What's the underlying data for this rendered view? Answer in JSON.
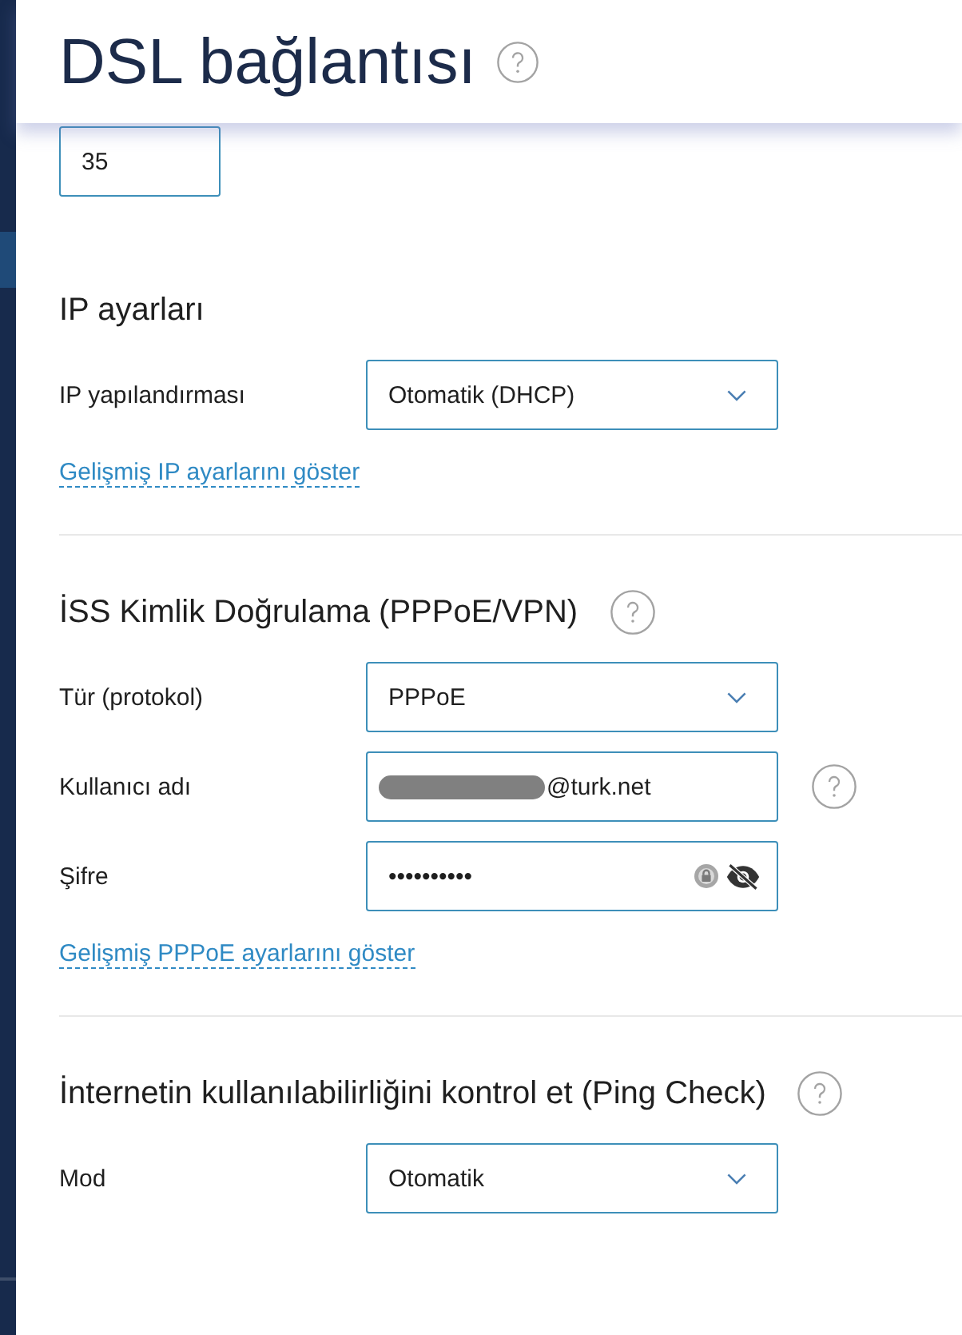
{
  "header": {
    "title": "DSL bağlantısı",
    "help": true
  },
  "top_field": {
    "value": "35"
  },
  "sections": [
    {
      "title": "IP ayarları",
      "rows": [
        {
          "label": "IP yapılandırması",
          "kind": "select",
          "value": "Otomatik (DHCP)"
        }
      ],
      "link": "Gelişmiş IP ayarlarını göster"
    },
    {
      "title": "İSS Kimlik Doğrulama (PPPoE/VPN)",
      "help": true,
      "rows": [
        {
          "label": "Tür (protokol)",
          "kind": "select",
          "value": "PPPoE"
        },
        {
          "label": "Kullanıcı adı",
          "kind": "text",
          "value": "@turk.net",
          "redacted": true,
          "help": true
        },
        {
          "label": "Şifre",
          "kind": "password",
          "value": "••••••••••"
        }
      ],
      "link": "Gelişmiş PPPoE ayarlarını göster"
    },
    {
      "title": "İnternetin kullanılabilirliğini kontrol et (Ping Check)",
      "help": true,
      "rows": [
        {
          "label": "Mod",
          "kind": "select",
          "value": "Otomatik"
        }
      ]
    }
  ]
}
